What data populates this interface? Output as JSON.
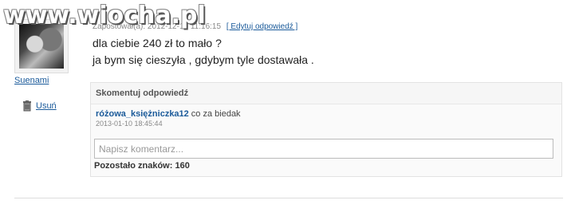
{
  "watermark": "www.wiocha.pl",
  "post": {
    "username": "Suenami",
    "meta_text": "Zapostował(a): 2012-12-15 11:16:15",
    "edit_label": "[ Edytuj odpowiedź ]",
    "answer_lines": [
      "dla ciebie 240 zł to mało ?",
      "ja bym się cieszyła , gdybym tyle dostawała ."
    ],
    "delete_label": "Usuń",
    "delete_icon": "trash-icon"
  },
  "comments": {
    "header": "Skomentuj odpowiedź",
    "items": [
      {
        "author": "różowa_księżniczka12",
        "text": "co za biedak",
        "date": "2013-01-10 18:45:44"
      }
    ],
    "input_placeholder": "Napisz komentarz...",
    "remaining_label": "Pozostało znaków: 160"
  },
  "colors": {
    "link": "#1a5a9a",
    "meta": "#888888",
    "border": "#e3e3e3"
  }
}
